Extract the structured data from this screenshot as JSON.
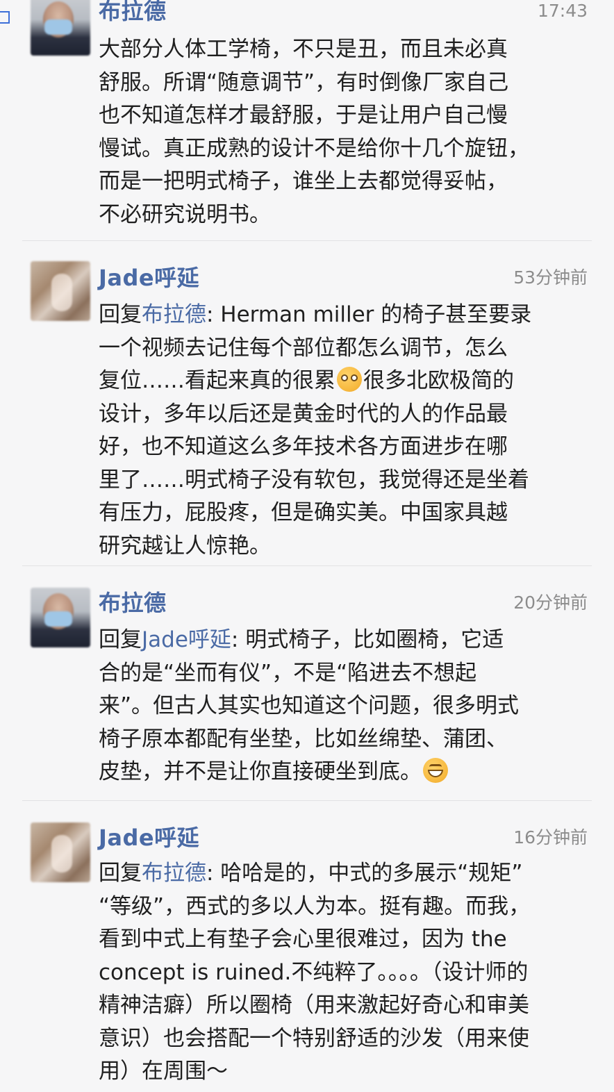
{
  "comments": [
    {
      "author": "布拉德",
      "time": "17:43",
      "reply_prefix": "",
      "reply_to": "",
      "text": "大部分人体工学椅，不只是丑，而且未必真\n舒服。所谓“随意调节”，有时倒像厂家自己\n也不知道怎样才最舒服，于是让用户自己慢\n慢试。真正成熟的设计不是给你十几个旋钮，\n而是一把明式椅子，谁坐上去都觉得妥帖，\n不必研究说明书。",
      "text_after": ""
    },
    {
      "author": "Jade呼延",
      "time": "53分钟前",
      "reply_prefix": "回复",
      "reply_to": "布拉德",
      "text": ": Herman miller 的椅子甚至要录\n一个视频去记住每个部位都怎么调节，怎么\n复位……看起来真的很累",
      "emoji": "pleading-face-icon",
      "text_after": "很多北欧极简的\n设计，多年以后还是黄金时代的人的作品最\n好，也不知道这么多年技术各方面进步在哪\n里了……明式椅子没有软包，我觉得还是坐着\n有压力，屁股疼，但是确实美。中国家具越\n研究越让人惊艳。"
    },
    {
      "author": "布拉德",
      "time": "20分钟前",
      "reply_prefix": "回复",
      "reply_to": "Jade呼延",
      "text": ": 明式椅子，比如圈椅，它适\n合的是“坐而有仪”，不是“陷进去不想起\n来”。但古人其实也知道这个问题，很多明式\n椅子原本都配有坐垫，比如丝绵垫、蒲团、\n皮垫，并不是让你直接硬坐到底。",
      "emoji": "grinning-face-icon",
      "text_after": ""
    },
    {
      "author": "Jade呼延",
      "time": "16分钟前",
      "reply_prefix": "回复",
      "reply_to": "布拉德",
      "text": ": 哈哈是的，中式的多展示“规矩”\n“等级”，西式的多以人为本。挺有趣。而我，\n看到中式上有垫子会心里很难过，因为 the\nconcept is ruined.不纯粹了。。。。（设计师的\n精神洁癖）所以圈椅（用来激起好奇心和审美\n意识）也会搭配一个特别舒适的沙发（用来使\n用）在周围～",
      "text_after": ""
    }
  ]
}
